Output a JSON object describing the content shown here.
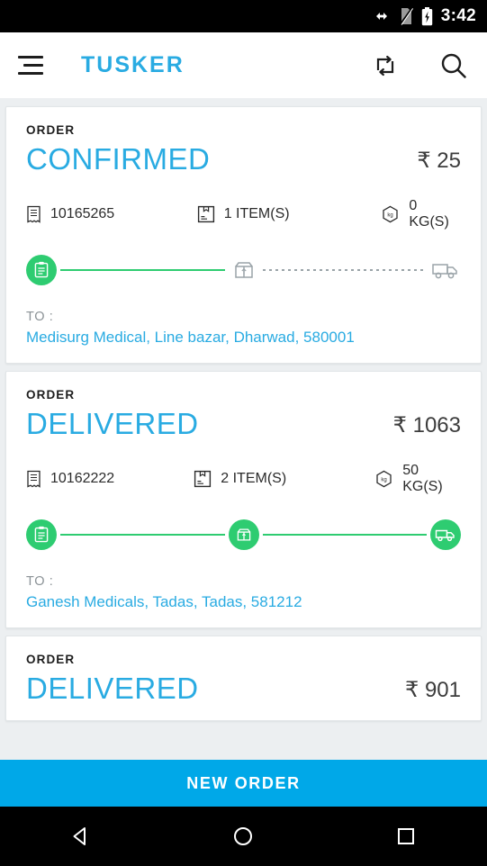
{
  "status_bar": {
    "time": "3:42",
    "icons": [
      "usb-data-icon",
      "no-sim-icon",
      "battery-charging-icon"
    ]
  },
  "toolbar": {
    "menu_icon": "hamburger-menu-icon",
    "title": "TUSKER",
    "refresh_icon": "repeat-refresh-icon",
    "search_icon": "search-icon",
    "brand_color": "#29abe2"
  },
  "colors": {
    "accent_blue": "#29abe2",
    "progress_green": "#2ecc71",
    "button_blue": "#00a8e8",
    "page_background": "#eceff1"
  },
  "orders": [
    {
      "label": "ORDER",
      "status": "CONFIRMED",
      "amount": "₹ 25",
      "order_number": "10165265",
      "items": "1 ITEM(S)",
      "weight": "0 KG(S)",
      "to_label": "TO :",
      "address": "Medisurg Medical, Line bazar, Dharwad, 580001",
      "progress": {
        "ordered": "done",
        "packed": "pending",
        "shipped": "pending",
        "segment_1": "done",
        "segment_2": "pending"
      }
    },
    {
      "label": "ORDER",
      "status": "DELIVERED",
      "amount": "₹ 1063",
      "order_number": "10162222",
      "items": "2 ITEM(S)",
      "weight": "50 KG(S)",
      "to_label": "TO :",
      "address": "Ganesh Medicals, Tadas, Tadas, 581212",
      "progress": {
        "ordered": "done",
        "packed": "done",
        "shipped": "done",
        "segment_1": "done",
        "segment_2": "done"
      }
    },
    {
      "label": "ORDER",
      "status": "DELIVERED",
      "amount": "₹ 901"
    }
  ],
  "bottom_button": {
    "label": "NEW ORDER"
  },
  "nav_bar": {
    "back": "back-triangle-icon",
    "home": "home-circle-icon",
    "recents": "recents-square-icon"
  }
}
